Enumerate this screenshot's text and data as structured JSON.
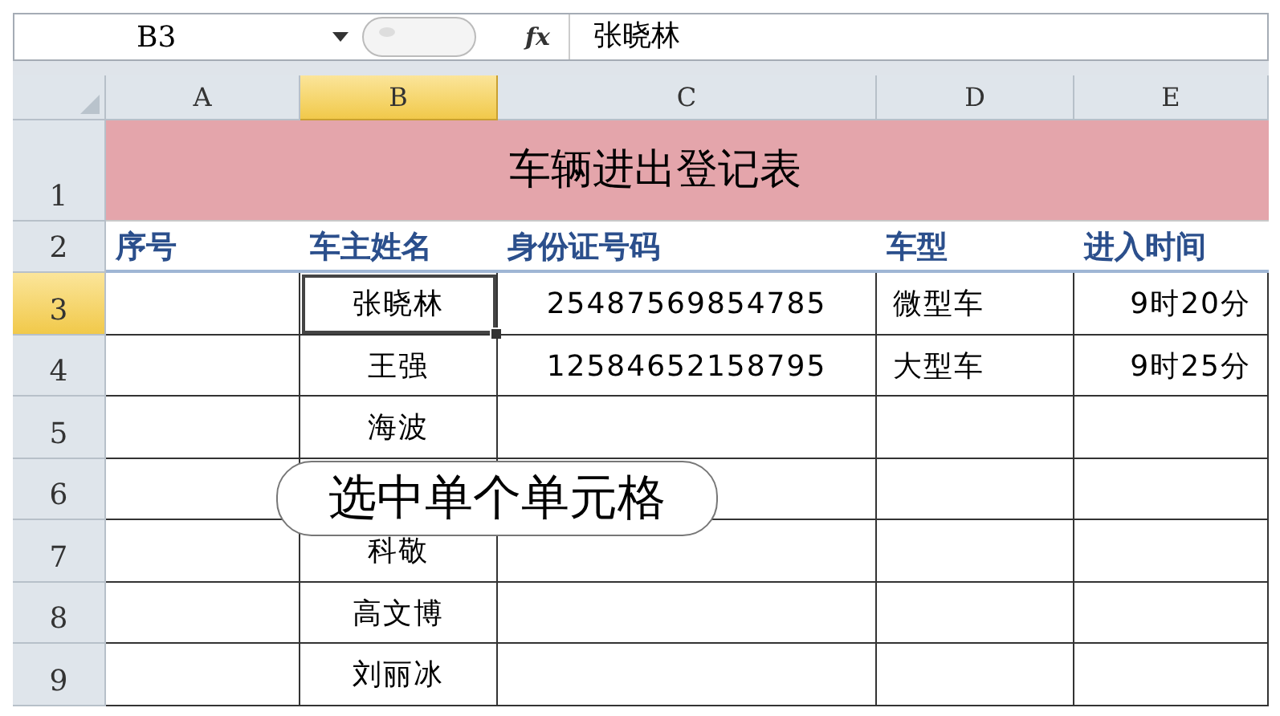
{
  "formula_bar": {
    "name_box": "B3",
    "function_label": "fx",
    "content": "张晓林"
  },
  "columns": [
    {
      "label": "A",
      "selected": false
    },
    {
      "label": "B",
      "selected": true
    },
    {
      "label": "C",
      "selected": false
    },
    {
      "label": "D",
      "selected": false
    },
    {
      "label": "E",
      "selected": false
    }
  ],
  "title_row": {
    "number": "1",
    "title": "车辆进出登记表"
  },
  "header_row": {
    "number": "2",
    "cells": [
      "序号",
      "车主姓名",
      "身份证号码",
      "车型",
      "进入时间"
    ]
  },
  "rows": [
    {
      "number": "3",
      "selected": true,
      "cells": [
        null,
        "张晓林",
        "25487569854785",
        "微型车",
        "9时20分"
      ]
    },
    {
      "number": "4",
      "selected": false,
      "cells": [
        null,
        "王强",
        "12584652158795",
        "大型车",
        "9时25分"
      ]
    },
    {
      "number": "5",
      "selected": false,
      "cells": [
        null,
        "海波",
        null,
        null,
        null
      ]
    },
    {
      "number": "6",
      "selected": false,
      "cells": [
        null,
        null,
        null,
        null,
        null
      ]
    },
    {
      "number": "7",
      "selected": false,
      "cells": [
        null,
        "科敬",
        null,
        null,
        null
      ]
    },
    {
      "number": "8",
      "selected": false,
      "cells": [
        null,
        "高文博",
        null,
        null,
        null
      ]
    },
    {
      "number": "9",
      "selected": false,
      "cells": [
        null,
        "刘丽冰",
        null,
        null,
        null
      ]
    }
  ],
  "callout": "选中单个单元格"
}
